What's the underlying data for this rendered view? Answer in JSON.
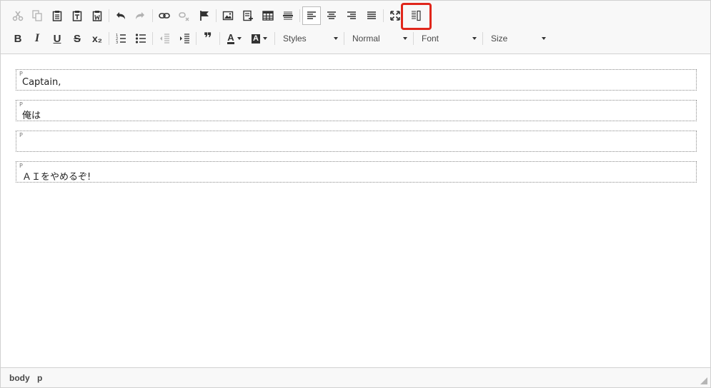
{
  "toolbar": {
    "row1": [
      {
        "name": "cut-icon",
        "state": "disabled"
      },
      {
        "name": "copy-icon",
        "state": "disabled"
      },
      {
        "name": "paste-icon",
        "state": "normal"
      },
      {
        "name": "paste-text-icon",
        "state": "normal"
      },
      {
        "name": "paste-from-word-icon",
        "state": "normal"
      },
      {
        "name": "undo-icon",
        "state": "normal"
      },
      {
        "name": "redo-icon",
        "state": "disabled"
      },
      {
        "name": "link-icon",
        "state": "normal"
      },
      {
        "name": "unlink-icon",
        "state": "disabled"
      },
      {
        "name": "anchor-flag-icon",
        "state": "normal"
      },
      {
        "name": "image-icon",
        "state": "normal"
      },
      {
        "name": "insert-template-icon",
        "state": "normal"
      },
      {
        "name": "table-icon",
        "state": "normal"
      },
      {
        "name": "horizontal-rule-icon",
        "state": "normal"
      },
      {
        "name": "align-left-icon",
        "state": "pressed"
      },
      {
        "name": "align-center-icon",
        "state": "normal"
      },
      {
        "name": "align-right-icon",
        "state": "normal"
      },
      {
        "name": "align-justify-icon",
        "state": "normal"
      },
      {
        "name": "maximize-icon",
        "state": "normal"
      },
      {
        "name": "show-blocks-icon",
        "state": "normal",
        "highlighted": true
      }
    ],
    "row2_glyphs": {
      "bold": "B",
      "italic": "I",
      "underline": "U",
      "strike": "S",
      "subscript": "x₂",
      "blockquote": "❞",
      "text_color": "A",
      "bg_color": "A"
    },
    "combos": {
      "styles": "Styles",
      "format": "Normal",
      "font": "Font",
      "size": "Size"
    },
    "highlight_color": "#e0261b"
  },
  "content": {
    "paragraphs": [
      {
        "tag": "P",
        "text": "Captain,"
      },
      {
        "tag": "P",
        "text": "俺は"
      },
      {
        "tag": "P",
        "text": ""
      },
      {
        "tag": "P",
        "text": "ＡＩをやめるぞ!"
      }
    ]
  },
  "statusbar": {
    "path": [
      "body",
      "p"
    ]
  }
}
